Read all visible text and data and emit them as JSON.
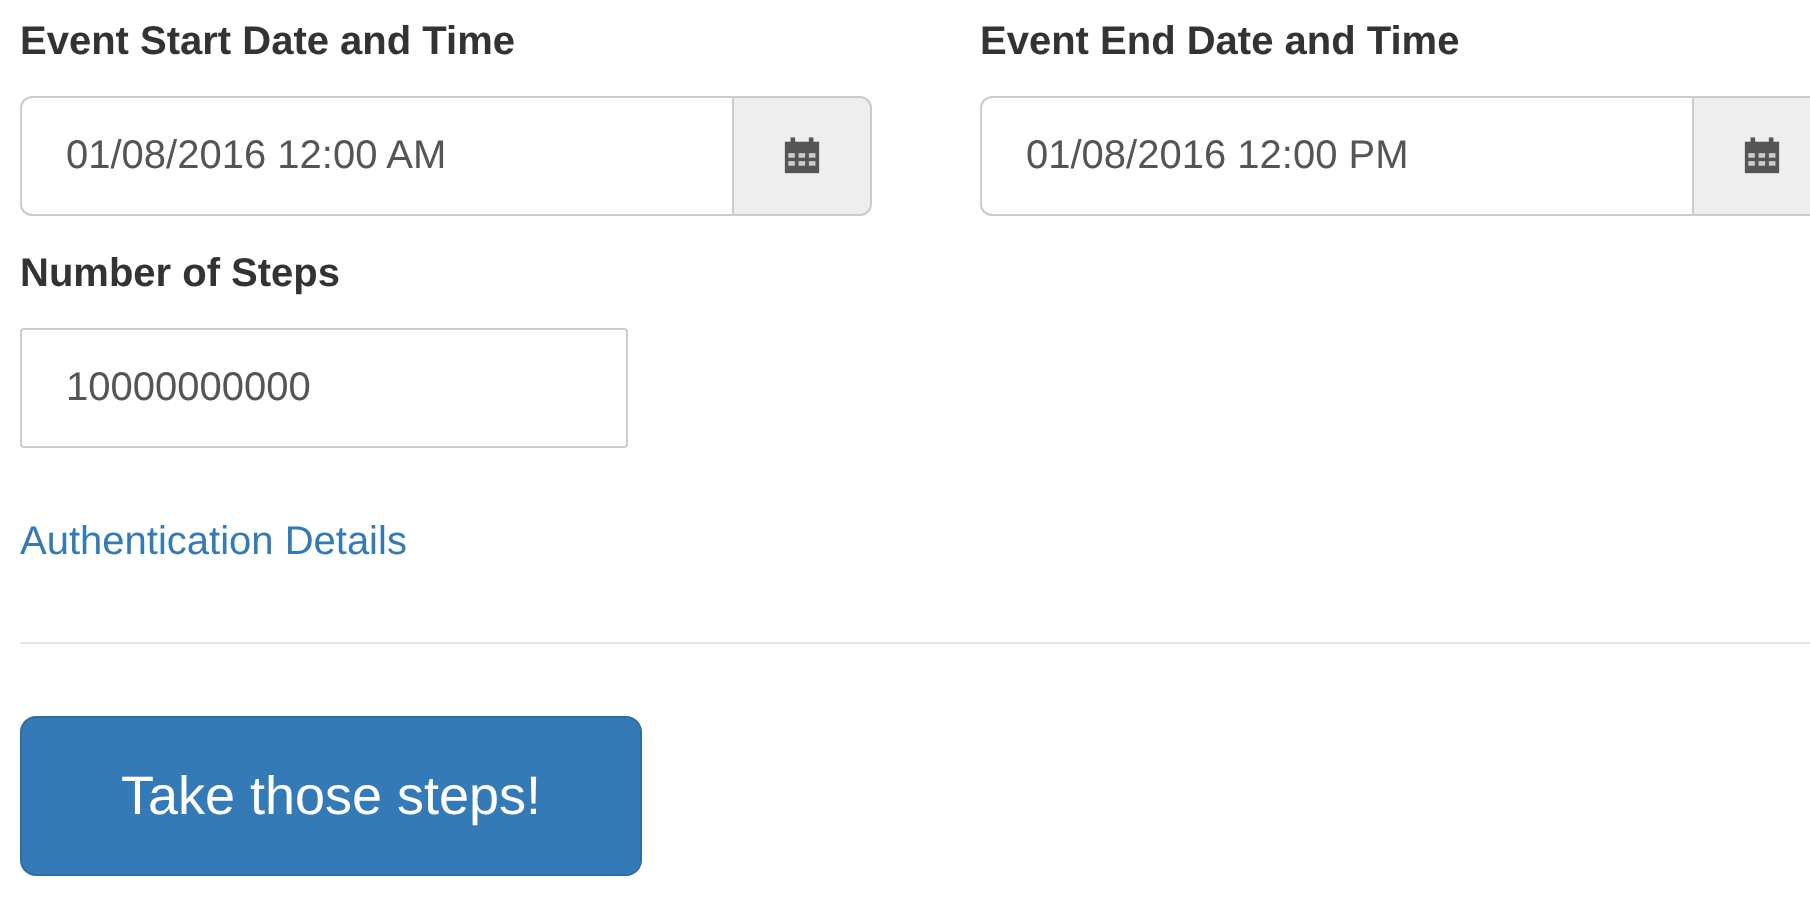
{
  "date_fields": [
    {
      "label": "Event Start Date and Time",
      "value": "01/08/2016 12:00 AM"
    },
    {
      "label": "Event End Date and Time",
      "value": "01/08/2016 12:00 PM"
    }
  ],
  "steps_field": {
    "label": "Number of Steps",
    "value": "10000000000"
  },
  "auth_link": "Authentication Details",
  "submit_button": "Take those steps!"
}
